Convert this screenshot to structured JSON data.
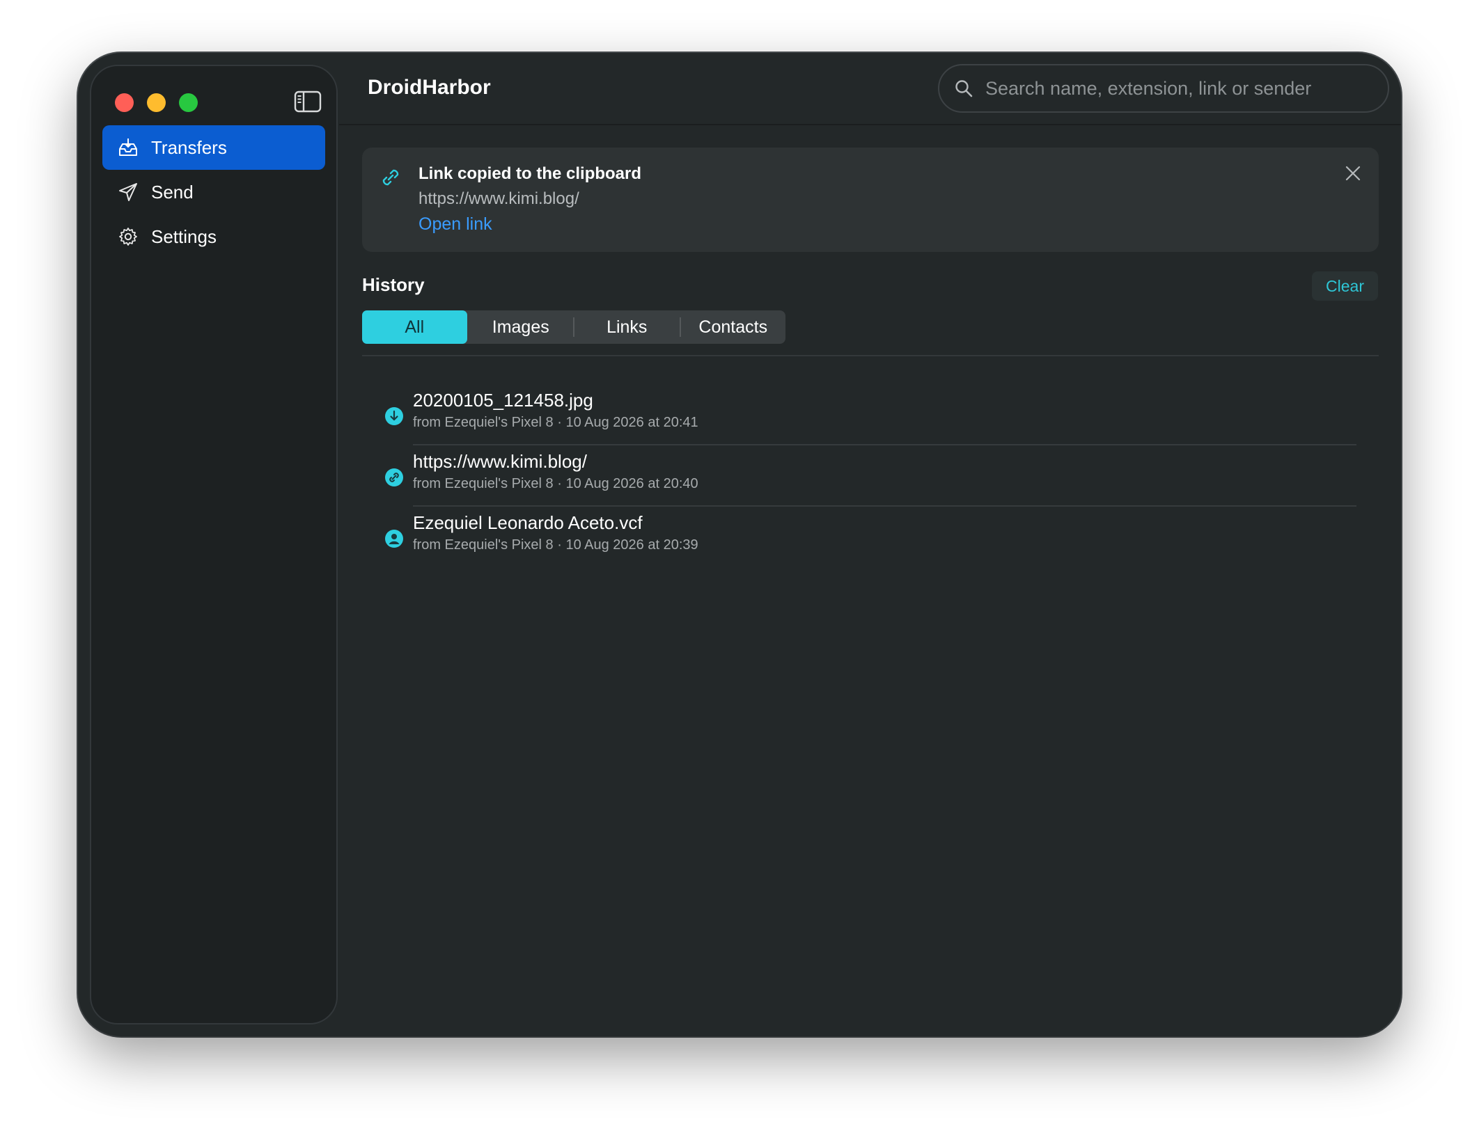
{
  "window": {
    "title": "DroidHarbor"
  },
  "search": {
    "placeholder": "Search name, extension, link or sender"
  },
  "sidebar": {
    "items": [
      {
        "label": "Transfers",
        "icon": "inbox-tray-icon",
        "active": true
      },
      {
        "label": "Send",
        "icon": "paper-plane-icon",
        "active": false
      },
      {
        "label": "Settings",
        "icon": "gear-icon",
        "active": false
      }
    ]
  },
  "toast": {
    "title": "Link copied to the clipboard",
    "url": "https://www.kimi.blog/",
    "action": "Open link",
    "icon": "link-icon"
  },
  "history": {
    "title": "History",
    "clear_label": "Clear",
    "filters": [
      {
        "label": "All",
        "active": true
      },
      {
        "label": "Images",
        "active": false
      },
      {
        "label": "Links",
        "active": false
      },
      {
        "label": "Contacts",
        "active": false
      }
    ],
    "items": [
      {
        "name": "20200105_121458.jpg",
        "meta": "from Ezequiel's Pixel 8 · 10 Aug 2026 at 20:41",
        "icon": "download-circle-icon"
      },
      {
        "name": "https://www.kimi.blog/",
        "meta": "from Ezequiel's Pixel 8 · 10 Aug 2026 at 20:40",
        "icon": "link-circle-icon"
      },
      {
        "name": "Ezequiel Leonardo Aceto.vcf",
        "meta": "from Ezequiel's Pixel 8 · 10 Aug 2026 at 20:39",
        "icon": "contact-circle-icon"
      }
    ]
  },
  "colors": {
    "accent": "#2ecfe0",
    "sidebar_active": "#0b5dd1",
    "link": "#3a9cff",
    "window_bg": "#232829"
  }
}
